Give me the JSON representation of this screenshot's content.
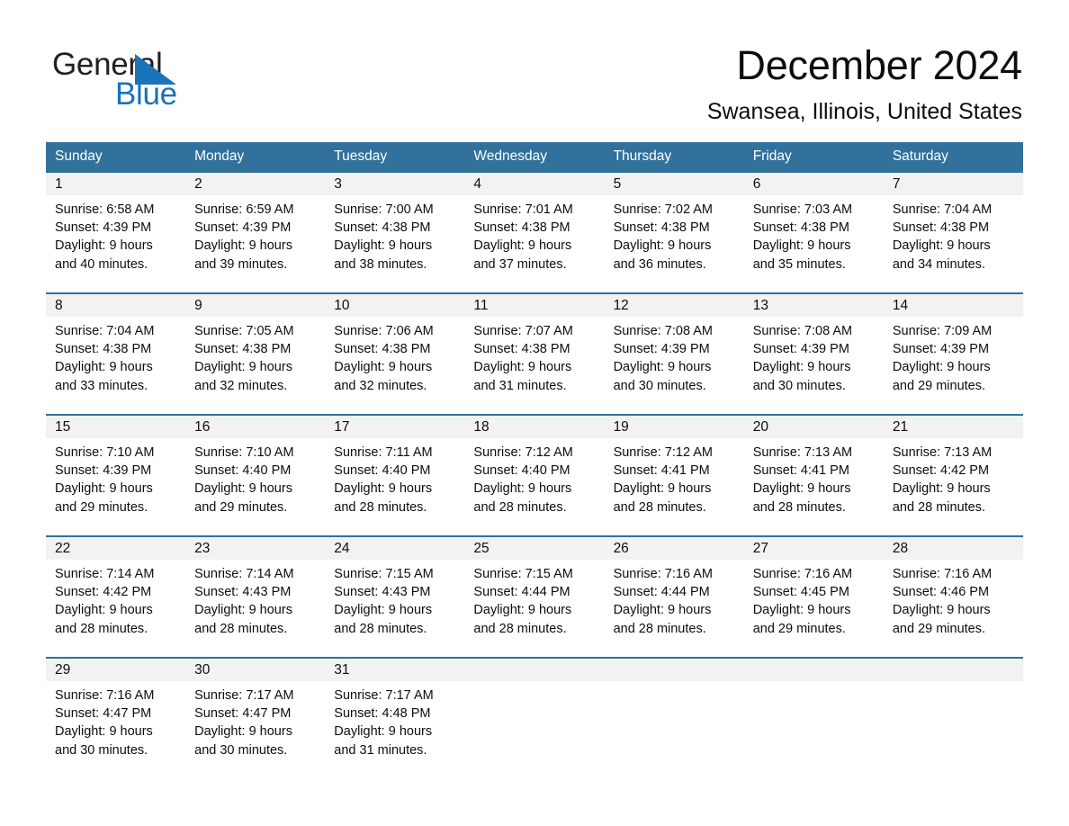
{
  "brand": {
    "name_part1": "General",
    "name_part2": "Blue",
    "accent_color": "#1b73b8"
  },
  "header": {
    "month_title": "December 2024",
    "location": "Swansea, Illinois, United States"
  },
  "calendar": {
    "header_bg": "#31719b",
    "daynum_band_bg": "#f2f2f2",
    "rule_color": "#31719b",
    "weekday_headers": [
      "Sunday",
      "Monday",
      "Tuesday",
      "Wednesday",
      "Thursday",
      "Friday",
      "Saturday"
    ],
    "weeks": [
      [
        {
          "day": "1",
          "sunrise": "Sunrise: 6:58 AM",
          "sunset": "Sunset: 4:39 PM",
          "daylight_line1": "Daylight: 9 hours",
          "daylight_line2": "and 40 minutes."
        },
        {
          "day": "2",
          "sunrise": "Sunrise: 6:59 AM",
          "sunset": "Sunset: 4:39 PM",
          "daylight_line1": "Daylight: 9 hours",
          "daylight_line2": "and 39 minutes."
        },
        {
          "day": "3",
          "sunrise": "Sunrise: 7:00 AM",
          "sunset": "Sunset: 4:38 PM",
          "daylight_line1": "Daylight: 9 hours",
          "daylight_line2": "and 38 minutes."
        },
        {
          "day": "4",
          "sunrise": "Sunrise: 7:01 AM",
          "sunset": "Sunset: 4:38 PM",
          "daylight_line1": "Daylight: 9 hours",
          "daylight_line2": "and 37 minutes."
        },
        {
          "day": "5",
          "sunrise": "Sunrise: 7:02 AM",
          "sunset": "Sunset: 4:38 PM",
          "daylight_line1": "Daylight: 9 hours",
          "daylight_line2": "and 36 minutes."
        },
        {
          "day": "6",
          "sunrise": "Sunrise: 7:03 AM",
          "sunset": "Sunset: 4:38 PM",
          "daylight_line1": "Daylight: 9 hours",
          "daylight_line2": "and 35 minutes."
        },
        {
          "day": "7",
          "sunrise": "Sunrise: 7:04 AM",
          "sunset": "Sunset: 4:38 PM",
          "daylight_line1": "Daylight: 9 hours",
          "daylight_line2": "and 34 minutes."
        }
      ],
      [
        {
          "day": "8",
          "sunrise": "Sunrise: 7:04 AM",
          "sunset": "Sunset: 4:38 PM",
          "daylight_line1": "Daylight: 9 hours",
          "daylight_line2": "and 33 minutes."
        },
        {
          "day": "9",
          "sunrise": "Sunrise: 7:05 AM",
          "sunset": "Sunset: 4:38 PM",
          "daylight_line1": "Daylight: 9 hours",
          "daylight_line2": "and 32 minutes."
        },
        {
          "day": "10",
          "sunrise": "Sunrise: 7:06 AM",
          "sunset": "Sunset: 4:38 PM",
          "daylight_line1": "Daylight: 9 hours",
          "daylight_line2": "and 32 minutes."
        },
        {
          "day": "11",
          "sunrise": "Sunrise: 7:07 AM",
          "sunset": "Sunset: 4:38 PM",
          "daylight_line1": "Daylight: 9 hours",
          "daylight_line2": "and 31 minutes."
        },
        {
          "day": "12",
          "sunrise": "Sunrise: 7:08 AM",
          "sunset": "Sunset: 4:39 PM",
          "daylight_line1": "Daylight: 9 hours",
          "daylight_line2": "and 30 minutes."
        },
        {
          "day": "13",
          "sunrise": "Sunrise: 7:08 AM",
          "sunset": "Sunset: 4:39 PM",
          "daylight_line1": "Daylight: 9 hours",
          "daylight_line2": "and 30 minutes."
        },
        {
          "day": "14",
          "sunrise": "Sunrise: 7:09 AM",
          "sunset": "Sunset: 4:39 PM",
          "daylight_line1": "Daylight: 9 hours",
          "daylight_line2": "and 29 minutes."
        }
      ],
      [
        {
          "day": "15",
          "sunrise": "Sunrise: 7:10 AM",
          "sunset": "Sunset: 4:39 PM",
          "daylight_line1": "Daylight: 9 hours",
          "daylight_line2": "and 29 minutes."
        },
        {
          "day": "16",
          "sunrise": "Sunrise: 7:10 AM",
          "sunset": "Sunset: 4:40 PM",
          "daylight_line1": "Daylight: 9 hours",
          "daylight_line2": "and 29 minutes."
        },
        {
          "day": "17",
          "sunrise": "Sunrise: 7:11 AM",
          "sunset": "Sunset: 4:40 PM",
          "daylight_line1": "Daylight: 9 hours",
          "daylight_line2": "and 28 minutes."
        },
        {
          "day": "18",
          "sunrise": "Sunrise: 7:12 AM",
          "sunset": "Sunset: 4:40 PM",
          "daylight_line1": "Daylight: 9 hours",
          "daylight_line2": "and 28 minutes."
        },
        {
          "day": "19",
          "sunrise": "Sunrise: 7:12 AM",
          "sunset": "Sunset: 4:41 PM",
          "daylight_line1": "Daylight: 9 hours",
          "daylight_line2": "and 28 minutes."
        },
        {
          "day": "20",
          "sunrise": "Sunrise: 7:13 AM",
          "sunset": "Sunset: 4:41 PM",
          "daylight_line1": "Daylight: 9 hours",
          "daylight_line2": "and 28 minutes."
        },
        {
          "day": "21",
          "sunrise": "Sunrise: 7:13 AM",
          "sunset": "Sunset: 4:42 PM",
          "daylight_line1": "Daylight: 9 hours",
          "daylight_line2": "and 28 minutes."
        }
      ],
      [
        {
          "day": "22",
          "sunrise": "Sunrise: 7:14 AM",
          "sunset": "Sunset: 4:42 PM",
          "daylight_line1": "Daylight: 9 hours",
          "daylight_line2": "and 28 minutes."
        },
        {
          "day": "23",
          "sunrise": "Sunrise: 7:14 AM",
          "sunset": "Sunset: 4:43 PM",
          "daylight_line1": "Daylight: 9 hours",
          "daylight_line2": "and 28 minutes."
        },
        {
          "day": "24",
          "sunrise": "Sunrise: 7:15 AM",
          "sunset": "Sunset: 4:43 PM",
          "daylight_line1": "Daylight: 9 hours",
          "daylight_line2": "and 28 minutes."
        },
        {
          "day": "25",
          "sunrise": "Sunrise: 7:15 AM",
          "sunset": "Sunset: 4:44 PM",
          "daylight_line1": "Daylight: 9 hours",
          "daylight_line2": "and 28 minutes."
        },
        {
          "day": "26",
          "sunrise": "Sunrise: 7:16 AM",
          "sunset": "Sunset: 4:44 PM",
          "daylight_line1": "Daylight: 9 hours",
          "daylight_line2": "and 28 minutes."
        },
        {
          "day": "27",
          "sunrise": "Sunrise: 7:16 AM",
          "sunset": "Sunset: 4:45 PM",
          "daylight_line1": "Daylight: 9 hours",
          "daylight_line2": "and 29 minutes."
        },
        {
          "day": "28",
          "sunrise": "Sunrise: 7:16 AM",
          "sunset": "Sunset: 4:46 PM",
          "daylight_line1": "Daylight: 9 hours",
          "daylight_line2": "and 29 minutes."
        }
      ],
      [
        {
          "day": "29",
          "sunrise": "Sunrise: 7:16 AM",
          "sunset": "Sunset: 4:47 PM",
          "daylight_line1": "Daylight: 9 hours",
          "daylight_line2": "and 30 minutes."
        },
        {
          "day": "30",
          "sunrise": "Sunrise: 7:17 AM",
          "sunset": "Sunset: 4:47 PM",
          "daylight_line1": "Daylight: 9 hours",
          "daylight_line2": "and 30 minutes."
        },
        {
          "day": "31",
          "sunrise": "Sunrise: 7:17 AM",
          "sunset": "Sunset: 4:48 PM",
          "daylight_line1": "Daylight: 9 hours",
          "daylight_line2": "and 31 minutes."
        },
        {
          "day": "",
          "sunrise": "",
          "sunset": "",
          "daylight_line1": "",
          "daylight_line2": ""
        },
        {
          "day": "",
          "sunrise": "",
          "sunset": "",
          "daylight_line1": "",
          "daylight_line2": ""
        },
        {
          "day": "",
          "sunrise": "",
          "sunset": "",
          "daylight_line1": "",
          "daylight_line2": ""
        },
        {
          "day": "",
          "sunrise": "",
          "sunset": "",
          "daylight_line1": "",
          "daylight_line2": ""
        }
      ]
    ]
  }
}
